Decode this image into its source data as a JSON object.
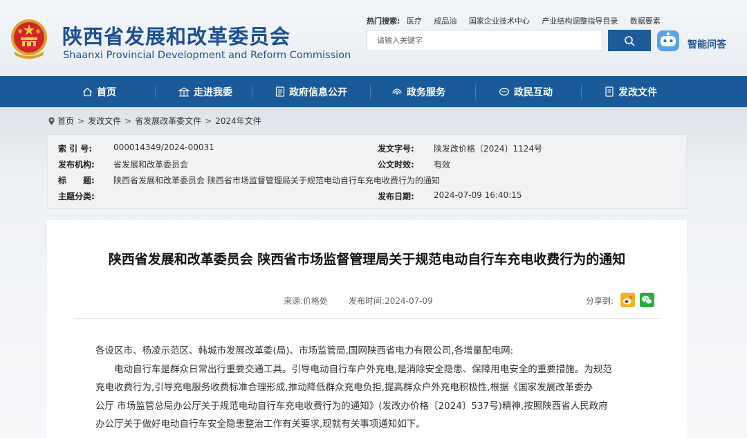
{
  "header": {
    "title_cn": "陕西省发展和改革委员会",
    "title_en": "Shaanxi Provincial Development and Reform Commission",
    "hot_search_label": "热门搜索:",
    "hot_search_links": [
      "医疗",
      "成品油",
      "国家企业技术中心",
      "产业结构调整指导目录",
      "数据要素"
    ],
    "search_placeholder": "请输入关键字",
    "ai_qa_label": "智能问答"
  },
  "nav": {
    "items": [
      {
        "label": "首页",
        "icon": "home-icon"
      },
      {
        "label": "走进我委",
        "icon": "building-icon"
      },
      {
        "label": "政府信息公开",
        "icon": "document-icon"
      },
      {
        "label": "政务服务",
        "icon": "broadcast-icon"
      },
      {
        "label": "政民互动",
        "icon": "chat-icon"
      },
      {
        "label": "发改文件",
        "icon": "file-icon"
      }
    ]
  },
  "breadcrumb": {
    "items": [
      "首页",
      "发改文件",
      "省发展改革委文件",
      "2024年文件"
    ],
    "separator": ">"
  },
  "meta": {
    "index_label": "索 引 号:",
    "index_value": "000014349/2024-00031",
    "doc_no_label": "发文字号:",
    "doc_no_value": "陕发改价格〔2024〕1124号",
    "issuer_label": "发布机构:",
    "issuer_value": "省发展和改革委员会",
    "validity_label": "公文时效:",
    "validity_value": "有效",
    "title_label_a": "标",
    "title_label_b": "题:",
    "title_value": "陕西省发展和改革委员会 陕西省市场监督管理局关于规范电动自行车充电收费行为的通知",
    "category_label": "主题分类:",
    "category_value": "",
    "date_label": "发布日期:",
    "date_value": "2024-07-09 16:40:15"
  },
  "article": {
    "title": "陕西省发展和改革委员会 陕西省市场监督管理局关于规范电动自行车充电收费行为的通知",
    "source": "来源:价格处",
    "publish_time": "发布时间:2024-07-09",
    "share_label": "分享到:",
    "paragraphs": [
      "各设区市、杨凌示范区、韩城市发展改革委(局)、市场监管局,国网陕西省电力有限公司,各增量配电网:",
      "电动自行车是群众日常出行重要交通工具。引导电动自行车户外充电,是消除安全隐患、保障用电安全的重要措施。为规范",
      "充电收费行为,引导充电服务收费标准合理形成,推动降低群众充电负担,提高群众户外充电积极性,根据《国家发展改革委办",
      "公厅 市场监管总局办公厅关于规范电动自行车充电收费行为的通知》(发改办价格〔2024〕537号)精神,按照陕西省人民政府",
      "办公厅关于做好电动自行车安全隐患整治工作有关要求,现就有关事项通知如下。"
    ]
  },
  "colors": {
    "brand_blue": "#1b4f94",
    "nav_blue": "#1a5a98",
    "search_button": "#1f5a99"
  }
}
